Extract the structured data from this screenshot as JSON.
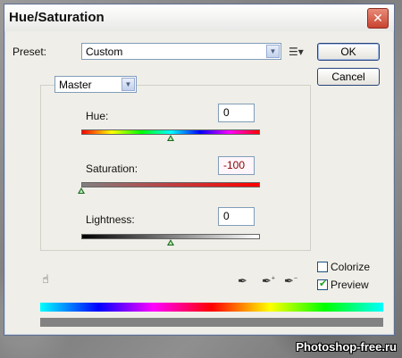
{
  "window": {
    "title": "Hue/Saturation",
    "close_label": "✕"
  },
  "preset": {
    "label": "Preset:",
    "value": "Custom"
  },
  "buttons": {
    "ok": "OK",
    "cancel": "Cancel"
  },
  "channel": {
    "value": "Master"
  },
  "hue": {
    "label": "Hue:",
    "value": "0",
    "position": 0.5
  },
  "saturation": {
    "label": "Saturation:",
    "value": "-100",
    "position": 0.0
  },
  "lightness": {
    "label": "Lightness:",
    "value": "0",
    "position": 0.5
  },
  "options": {
    "colorize_label": "Colorize",
    "colorize_checked": false,
    "preview_label": "Preview",
    "preview_checked": true
  },
  "watermark": "Photoshop-free.ru"
}
